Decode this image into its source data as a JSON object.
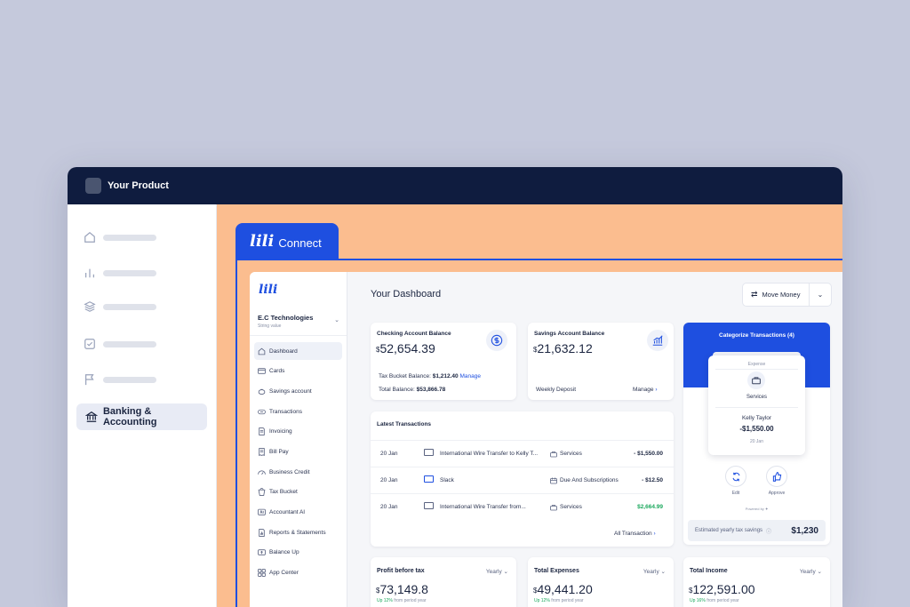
{
  "host": {
    "title": "Your Product",
    "sidebar_icons": [
      "home-icon",
      "bar-chart-icon",
      "layers-icon",
      "checkbox-icon",
      "flag-icon"
    ],
    "active_item": {
      "label": "Banking & Accounting",
      "icon": "bank-icon"
    }
  },
  "tab": {
    "logo": "lili",
    "label": "Connect"
  },
  "lili": {
    "logo": "lili",
    "company": {
      "name": "E.C Technologies",
      "sub": "String value"
    },
    "nav": [
      {
        "label": "Dashboard",
        "icon": "home-icon",
        "active": true
      },
      {
        "label": "Cards",
        "icon": "card-icon"
      },
      {
        "label": "Savings account",
        "icon": "piggy-bank-icon"
      },
      {
        "label": "Transactions",
        "icon": "transfer-icon"
      },
      {
        "label": "Invoicing",
        "icon": "invoice-icon"
      },
      {
        "label": "Bill Pay",
        "icon": "bill-icon"
      },
      {
        "label": "Business Credit",
        "icon": "gauge-icon"
      },
      {
        "label": "Tax Bucket",
        "icon": "bucket-icon"
      },
      {
        "label": "Accountant AI",
        "icon": "ai-icon"
      },
      {
        "label": "Reports & Statements",
        "icon": "report-icon"
      },
      {
        "label": "Balance Up",
        "icon": "balance-icon"
      },
      {
        "label": "App Center",
        "icon": "apps-icon"
      }
    ]
  },
  "dashboard": {
    "title": "Your Dashboard",
    "move_money": "Move Money",
    "checking": {
      "title": "Checking Account Balance",
      "currency": "$",
      "amount": "52,654.39",
      "tax_label": "Tax Bucket Balance:",
      "tax_value": "$1,212.40",
      "tax_link": "Manage",
      "total_label": "Total Balance:",
      "total_value": "$53,866.78"
    },
    "savings": {
      "title": "Savings Account Balance",
      "currency": "$",
      "amount": "21,632.12",
      "deposit_label": "Weekly Deposit",
      "manage_label": "Manage"
    },
    "transactions": {
      "title": "Latest Transactions",
      "rows": [
        {
          "date": "20 Jan",
          "desc": "International Wire Transfer to Kelly T...",
          "category": "Services",
          "amount": "- $1,550.00",
          "positive": false
        },
        {
          "date": "20 Jan",
          "desc": "Slack",
          "category": "Due And Subscriptions",
          "amount": "- $12.50",
          "positive": false
        },
        {
          "date": "20 Jan",
          "desc": "International Wire Transfer from...",
          "category": "Services",
          "amount": "$2,664.99",
          "positive": true
        }
      ],
      "all_label": "All Transaction"
    },
    "categorize": {
      "title": "Categorize Transactions (4)",
      "type": "Expense",
      "category": "Services",
      "name": "Kelly Taylor",
      "amount": "-$1,550.00",
      "date": "20 Jan",
      "edit_label": "Edit",
      "approve_label": "Approve",
      "powered": "Powered by",
      "est_label": "Estimated yearly tax savings",
      "est_value": "$1,230"
    },
    "profit": {
      "title": "Profit before tax",
      "period": "Yearly",
      "currency": "$",
      "amount": "73,149.8",
      "up": "Up 12%",
      "up_suffix": "from period year"
    },
    "expenses": {
      "title": "Total Expenses",
      "period": "Yearly",
      "currency": "$",
      "amount": "49,441.20",
      "up": "Up 12%",
      "up_suffix": "from period year"
    },
    "income": {
      "title": "Total Income",
      "period": "Yearly",
      "currency": "$",
      "amount": "122,591.00",
      "up": "Up 16%",
      "up_suffix": "from period year"
    }
  }
}
